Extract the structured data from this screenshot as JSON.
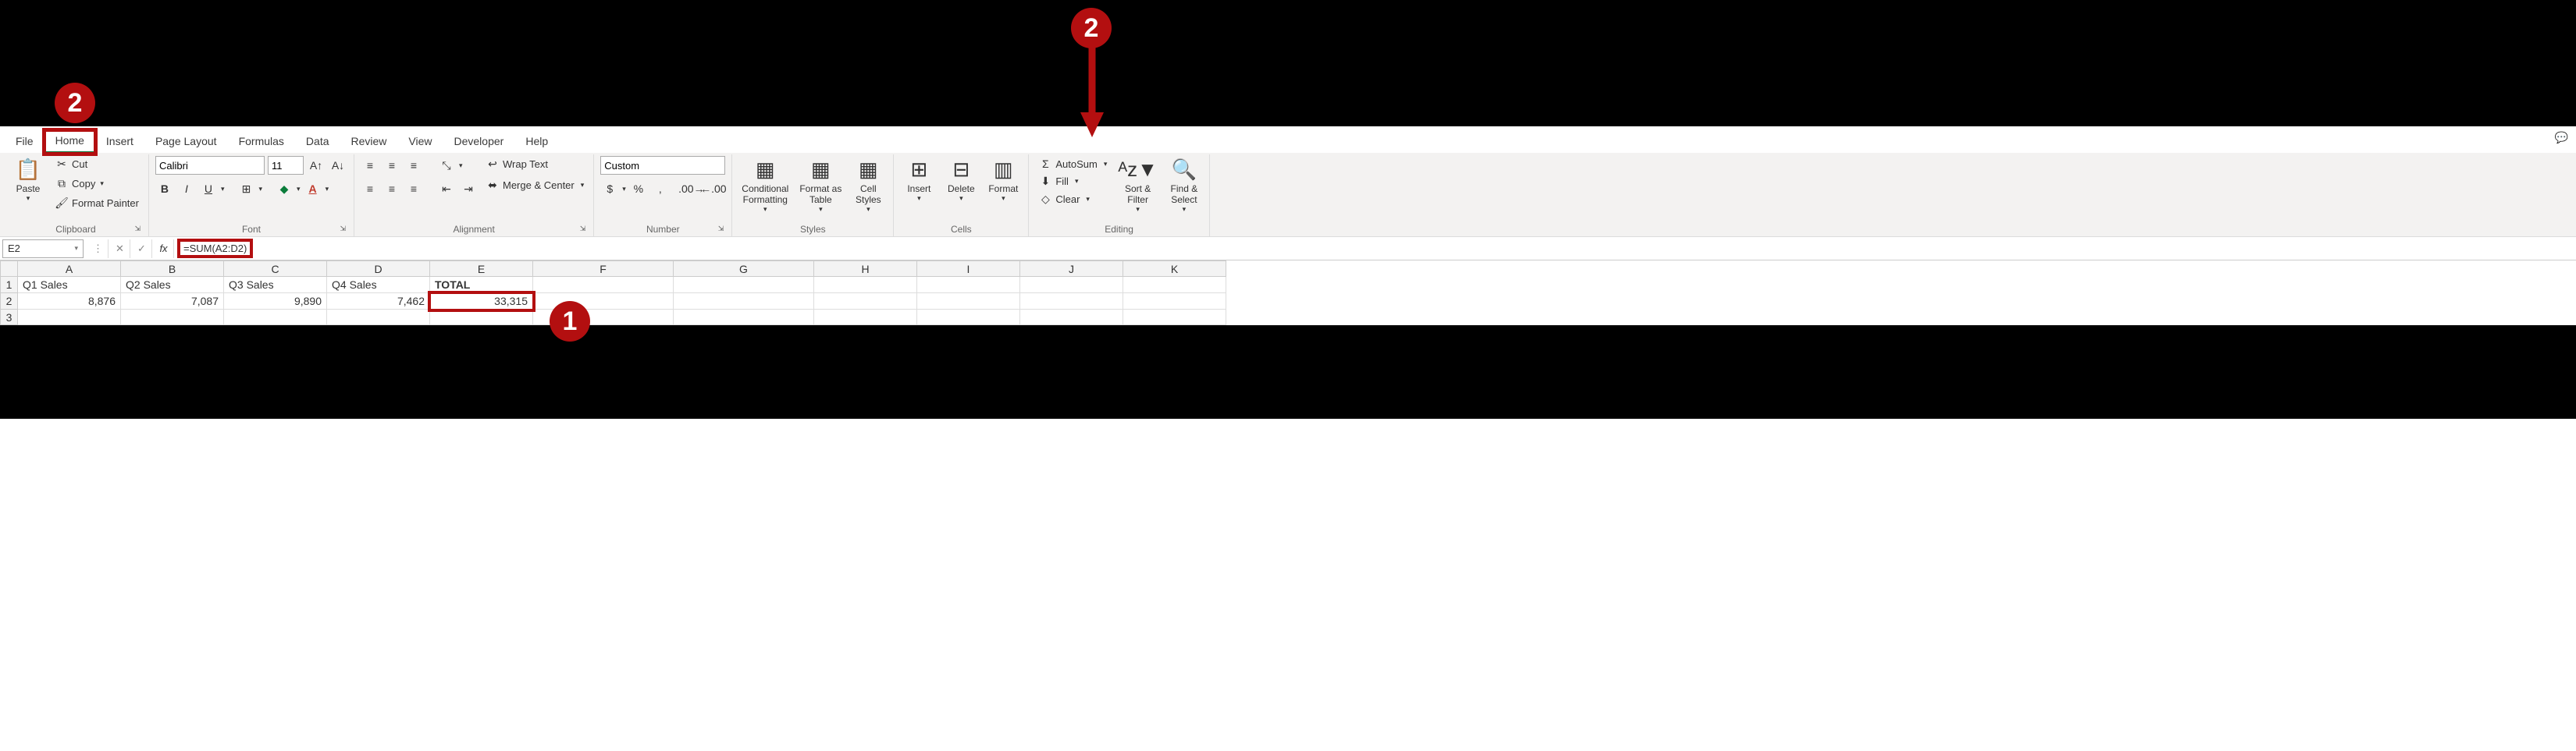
{
  "tabs": [
    "File",
    "Home",
    "Insert",
    "Page Layout",
    "Formulas",
    "Data",
    "Review",
    "View",
    "Developer",
    "Help"
  ],
  "active_tab": "Home",
  "clipboard": {
    "cut": "Cut",
    "copy": "Copy",
    "painter": "Format Painter",
    "paste": "Paste",
    "label": "Clipboard"
  },
  "font": {
    "name": "Calibri",
    "size": "11",
    "bold": "B",
    "italic": "I",
    "underline": "U",
    "label": "Font"
  },
  "alignment": {
    "wrap": "Wrap Text",
    "merge": "Merge & Center",
    "label": "Alignment"
  },
  "number": {
    "format": "Custom",
    "label": "Number"
  },
  "styles": {
    "cond": "Conditional\nFormatting",
    "table": "Format as\nTable",
    "cell": "Cell\nStyles",
    "label": "Styles"
  },
  "cells": {
    "insert": "Insert",
    "delete": "Delete",
    "format": "Format",
    "label": "Cells"
  },
  "editing": {
    "autosum": "AutoSum",
    "fill": "Fill",
    "clear": "Clear",
    "sort": "Sort &\nFilter",
    "find": "Find &\nSelect",
    "label": "Editing"
  },
  "formula_bar": {
    "cell_ref": "E2",
    "formula": "=SUM(A2:D2)"
  },
  "columns": [
    "A",
    "B",
    "C",
    "D",
    "E",
    "F",
    "G",
    "H",
    "I",
    "J",
    "K"
  ],
  "rows": [
    "1",
    "2",
    "3"
  ],
  "headers": {
    "A": "Q1 Sales",
    "B": "Q2 Sales",
    "C": "Q3 Sales",
    "D": "Q4 Sales",
    "E": "TOTAL"
  },
  "values": {
    "A": "8,876",
    "B": "7,087",
    "C": "9,890",
    "D": "7,462",
    "E": "33,315"
  },
  "callouts": {
    "top_left": "2",
    "top_right": "2",
    "mid": "1"
  },
  "chart_data": {
    "type": "table",
    "columns": [
      "Q1 Sales",
      "Q2 Sales",
      "Q3 Sales",
      "Q4 Sales",
      "TOTAL"
    ],
    "rows": [
      [
        8876,
        7087,
        9890,
        7462,
        33315
      ]
    ],
    "formula": "=SUM(A2:D2)",
    "active_cell": "E2"
  }
}
